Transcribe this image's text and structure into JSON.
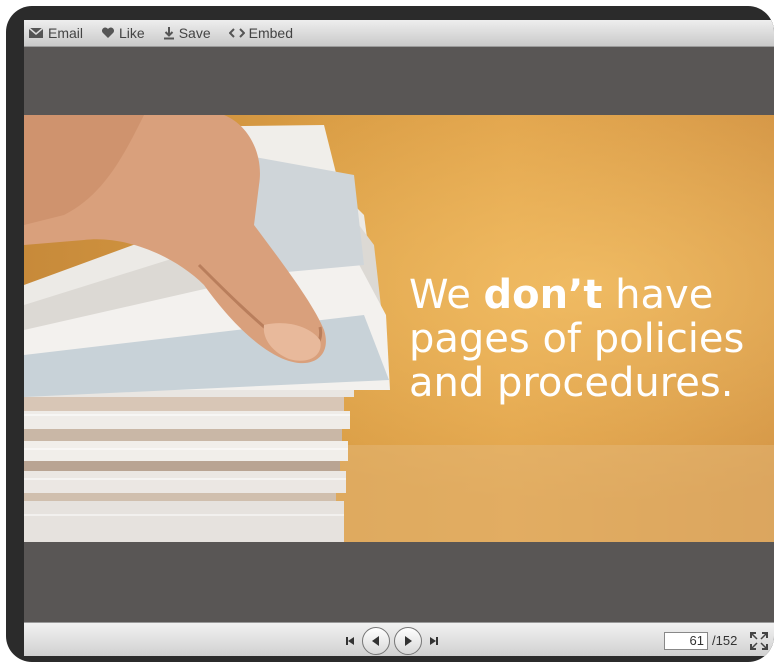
{
  "toolbar": {
    "email_label": "Email",
    "like_label": "Like",
    "save_label": "Save",
    "embed_label": "Embed"
  },
  "slide": {
    "line1_pre": "We ",
    "line1_bold": "don’t",
    "line1_post": " have",
    "line2": "pages of policies",
    "line3": "and procedures."
  },
  "pager": {
    "current_page": "61",
    "total_label": "/152"
  },
  "icons": {
    "email": "envelope-icon",
    "like": "heart-icon",
    "save": "download-icon",
    "embed": "code-icon",
    "first": "skip-first-icon",
    "prev": "prev-icon",
    "next": "next-icon",
    "last": "skip-last-icon",
    "fullscreen": "fullscreen-icon"
  },
  "colors": {
    "frame": "#2b2b2b",
    "viewer_bg": "#595655",
    "slide_orange": "#d99c44",
    "text_white": "#ffffff"
  }
}
